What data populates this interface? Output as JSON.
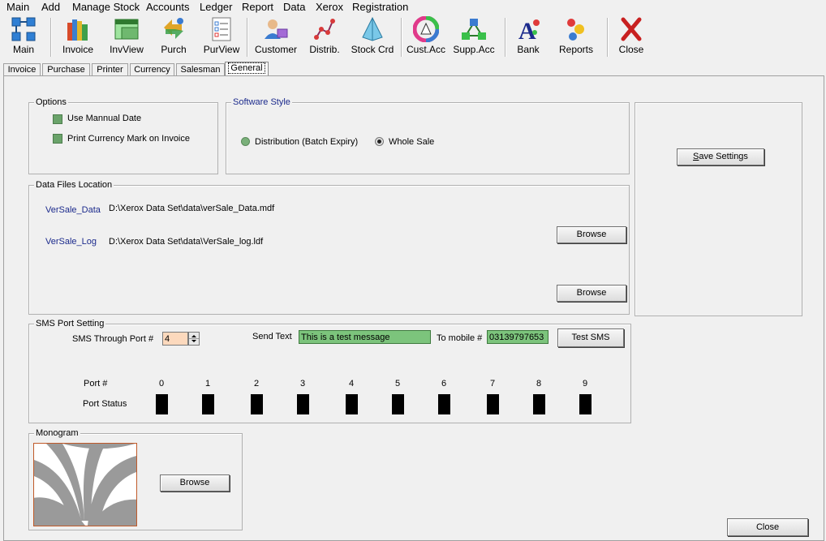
{
  "menu": {
    "items": [
      {
        "label": "Main"
      },
      {
        "label": "Add"
      },
      {
        "label": "Manage Stock"
      },
      {
        "label": "Accounts"
      },
      {
        "label": "Ledger"
      },
      {
        "label": "Report"
      },
      {
        "label": "Data"
      },
      {
        "label": "Xerox"
      },
      {
        "label": "Registration"
      }
    ]
  },
  "toolbar": {
    "buttons": [
      {
        "label": "Main",
        "icon": "grid-icon"
      },
      {
        "label": "Invoice",
        "icon": "books-icon"
      },
      {
        "label": "InvView",
        "icon": "window-icon"
      },
      {
        "label": "Purch",
        "icon": "arrows-icon"
      },
      {
        "label": "PurView",
        "icon": "checklist-icon"
      },
      {
        "label": "Customer",
        "icon": "customer-icon"
      },
      {
        "label": "Distrib.",
        "icon": "distribution-icon"
      },
      {
        "label": "Stock Crd",
        "icon": "pyramid-icon"
      },
      {
        "label": "Cust.Acc",
        "icon": "color-wheel-icon"
      },
      {
        "label": "Supp.Acc",
        "icon": "network-icon"
      },
      {
        "label": "Bank",
        "icon": "bank-letter-icon"
      },
      {
        "label": "Reports",
        "icon": "reports-icon"
      },
      {
        "label": "Close",
        "icon": "close-x-icon"
      }
    ]
  },
  "tabs": [
    {
      "label": "Invoice"
    },
    {
      "label": "Purchase"
    },
    {
      "label": "Printer"
    },
    {
      "label": "Currency"
    },
    {
      "label": "Salesman"
    },
    {
      "label": "General",
      "active": true
    }
  ],
  "options": {
    "title": "Options",
    "use_manual_date": "Use Mannual Date",
    "print_currency": "Print Currency Mark on Invoice"
  },
  "software_style": {
    "title": "Software Style",
    "distribution": "Distribution (Batch Expiry)",
    "wholesale": "Whole Sale",
    "selected": "Whole Sale"
  },
  "save_settings": {
    "label_first": "S",
    "label_rest": "ave Settings"
  },
  "data_files": {
    "title": "Data Files Location",
    "data_label": "VerSale_Data",
    "data_path": "D:\\Xerox Data Set\\data\\verSale_Data.mdf",
    "log_label": "VerSale_Log",
    "log_path": "D:\\Xerox Data Set\\data\\VerSale_log.ldf",
    "browse1": "Browse",
    "browse2": "Browse"
  },
  "sms": {
    "title": "SMS Port Setting",
    "through_port_label": "SMS Through Port #",
    "port_value": "4",
    "send_text_label": "Send Text",
    "send_text_value": "This is a test message",
    "to_mobile_label": "To mobile #",
    "mobile_value": "03139797653",
    "test_button": "Test SMS",
    "port_label": "Port #",
    "status_label": "Port Status",
    "ports": [
      "0",
      "1",
      "2",
      "3",
      "4",
      "5",
      "6",
      "7",
      "8",
      "9"
    ]
  },
  "monogram": {
    "title": "Monogram",
    "browse": "Browse"
  },
  "close_button": "Close",
  "colors": {
    "input_green": "#7cc47c",
    "port_input": "#fcd9bd",
    "group_title_blue": "#1b2a8c"
  }
}
